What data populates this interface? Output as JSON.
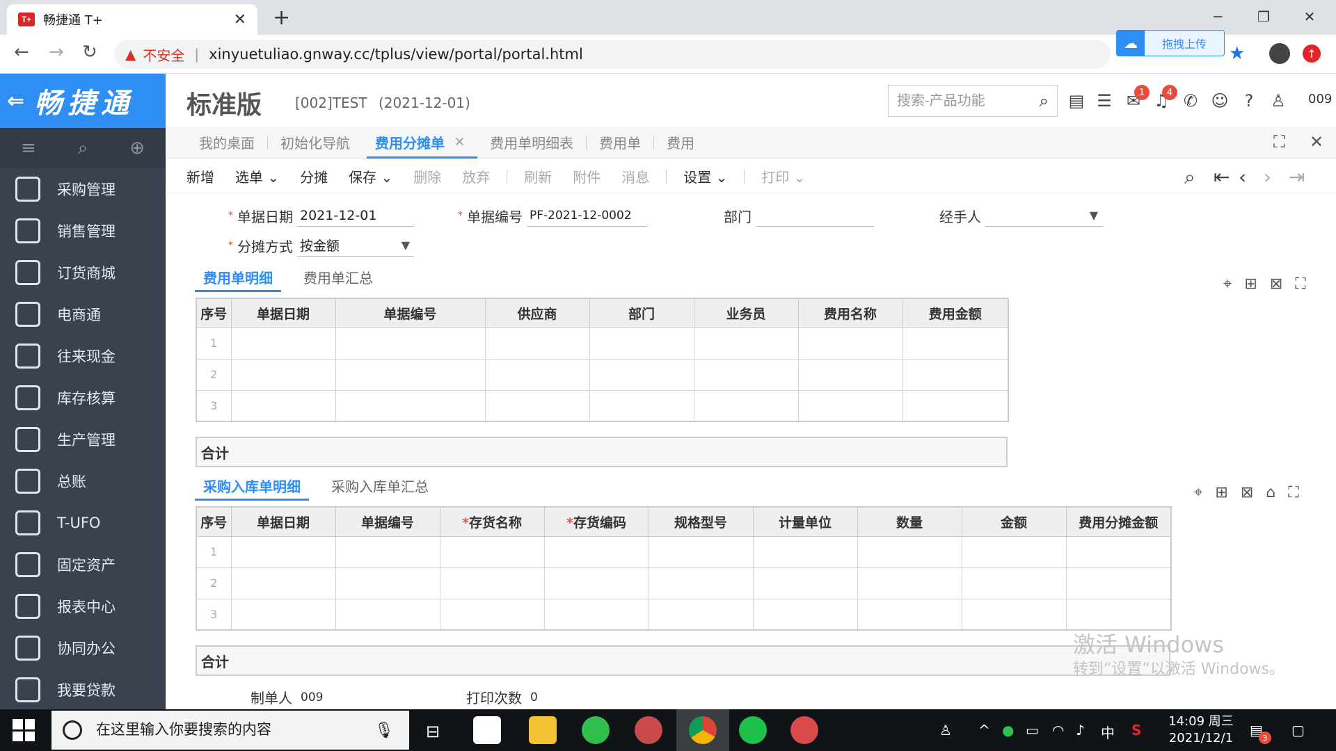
{
  "browser": {
    "tab_title": "畅捷通 T+",
    "tab_favicon": "T+",
    "insecure_label": "不安全",
    "url": "xinyuetuliao.gnway.cc/tplus/view/portal/portal.html",
    "upload_label": "拖拽上传"
  },
  "header": {
    "logo": "畅捷通",
    "edition": "标准版",
    "account": "[002]TEST",
    "date": "(2021-12-01)",
    "search_placeholder": "搜索-产品功能",
    "badge_messages": "1",
    "badge_alerts": "4",
    "user": "009"
  },
  "sidebar": {
    "items": [
      {
        "label": "采购管理",
        "icon": "purchase-icon"
      },
      {
        "label": "销售管理",
        "icon": "sales-icon"
      },
      {
        "label": "订货商城",
        "icon": "store-icon"
      },
      {
        "label": "电商通",
        "icon": "ecommerce-icon"
      },
      {
        "label": "往来现金",
        "icon": "cash-icon"
      },
      {
        "label": "库存核算",
        "icon": "inventory-icon"
      },
      {
        "label": "生产管理",
        "icon": "production-icon"
      },
      {
        "label": "总账",
        "icon": "ledger-icon"
      },
      {
        "label": "T-UFO",
        "icon": "ufo-icon"
      },
      {
        "label": "固定资产",
        "icon": "assets-icon"
      },
      {
        "label": "报表中心",
        "icon": "report-icon"
      },
      {
        "label": "协同办公",
        "icon": "office-icon"
      },
      {
        "label": "我要贷款",
        "icon": "loan-icon"
      }
    ]
  },
  "page_tabs": [
    "我的桌面",
    "初始化导航",
    "费用分摊单",
    "费用单明细表",
    "费用单",
    "费用"
  ],
  "toolbar": {
    "new": "新增",
    "select": "选单",
    "allocate": "分摊",
    "save": "保存",
    "delete": "删除",
    "discard": "放弃",
    "refresh": "刷新",
    "attach": "附件",
    "message": "消息",
    "settings": "设置",
    "print": "打印"
  },
  "form": {
    "date_label": "单据日期",
    "date_value": "2021-12-01",
    "code_label": "单据编号",
    "code_value": "PF-2021-12-0002",
    "dept_label": "部门",
    "dept_value": "",
    "handler_label": "经手人",
    "handler_value": "",
    "method_label": "分摊方式",
    "method_value": "按金额",
    "creator_label": "制单人",
    "creator_value": "009",
    "print_count_label": "打印次数",
    "print_count_value": "0"
  },
  "grid1": {
    "tabs": [
      "费用单明细",
      "费用单汇总"
    ],
    "columns": [
      "序号",
      "单据日期",
      "单据编号",
      "供应商",
      "部门",
      "业务员",
      "费用名称",
      "费用金额"
    ],
    "rows": [
      "1",
      "2",
      "3"
    ],
    "total_label": "合计"
  },
  "grid2": {
    "tabs": [
      "采购入库单明细",
      "采购入库单汇总"
    ],
    "columns": [
      "序号",
      "单据日期",
      "单据编号",
      "存货名称",
      "存货编码",
      "规格型号",
      "计量单位",
      "数量",
      "金额",
      "费用分摊金额"
    ],
    "required": [
      false,
      false,
      false,
      true,
      true,
      false,
      false,
      false,
      false,
      false
    ],
    "rows": [
      "1",
      "2",
      "3"
    ],
    "total_label": "合计"
  },
  "watermark": {
    "line1": "激活 Windows",
    "line2": "转到“设置”以激活 Windows。"
  },
  "taskbar": {
    "search_placeholder": "在这里输入你要搜索的内容",
    "ime": "中",
    "time": "14:09 周三",
    "date": "2021/12/1",
    "notif_count": "3"
  }
}
